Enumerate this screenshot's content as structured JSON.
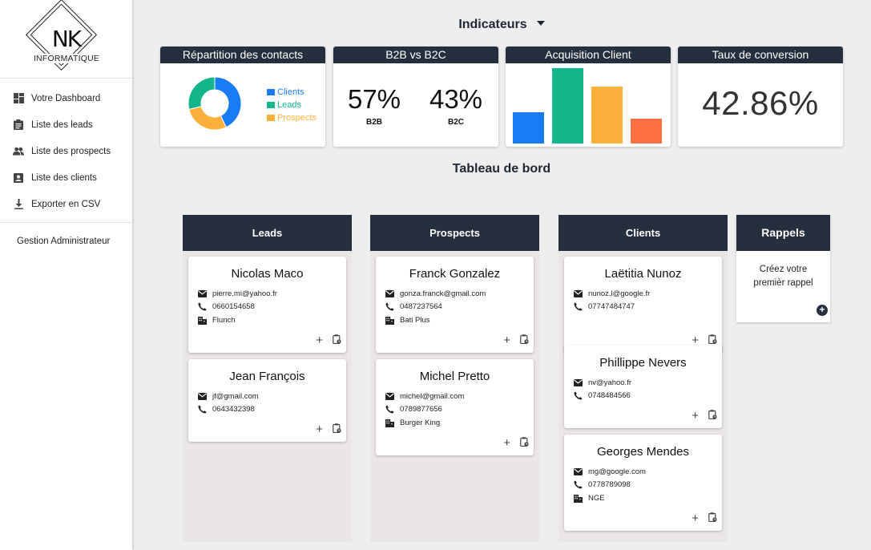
{
  "brand": {
    "logo_mark": "NK",
    "logo_text": "INFORMATIQUE"
  },
  "sidebar": {
    "items": [
      {
        "label": "Votre Dashboard",
        "icon": "dashboard-icon"
      },
      {
        "label": "Liste des leads",
        "icon": "clipboard-icon"
      },
      {
        "label": "Liste des prospects",
        "icon": "people-icon"
      },
      {
        "label": "Liste des clients",
        "icon": "contact-card-icon"
      },
      {
        "label": "Exporter en CSV",
        "icon": "download-icon"
      }
    ],
    "admin_label": "Gestion Administrateur"
  },
  "indicators": {
    "title": "Indicateurs",
    "contacts": {
      "title": "Répartition des contacts",
      "legend": [
        {
          "label": "Clients",
          "color": "#1a7cf5",
          "value": 3
        },
        {
          "label": "Leads",
          "color": "#12b68a",
          "value": 2
        },
        {
          "label": "Prospects",
          "color": "#fbb03b",
          "value": 2
        }
      ]
    },
    "b2b": {
      "title": "B2B vs B2C",
      "b2b_value": "57%",
      "b2b_label": "B2B",
      "b2c_value": "43%",
      "b2c_label": "B2C"
    },
    "acquisition": {
      "title": "Acquisition Client",
      "values": [
        40,
        97,
        73,
        32
      ],
      "max": 100,
      "colors": [
        "#1a7cf5",
        "#12b68a",
        "#fbb03b",
        "#ff7043"
      ]
    },
    "conversion": {
      "title": "Taux de conversion",
      "value": "42.86%"
    }
  },
  "dashboard": {
    "title": "Tableau de bord",
    "columns": [
      {
        "title": "Leads",
        "cards": [
          {
            "name": "Nicolas Maco",
            "email": "pierre.mi@yahoo.fr",
            "phone": "0660154658",
            "company": "Flunch"
          },
          {
            "name": "Jean François",
            "email": "jf@gmail.com",
            "phone": "0643432398",
            "company": ""
          }
        ]
      },
      {
        "title": "Prospects",
        "cards": [
          {
            "name": "Franck Gonzalez",
            "email": "gonza.franck@gmail.com",
            "phone": "0487237564",
            "company": "Bati Plus"
          },
          {
            "name": "Michel Pretto",
            "email": "michel@gmail.com",
            "phone": "0789877656",
            "company": "Burger King"
          }
        ]
      },
      {
        "title": "Clients",
        "cards": [
          {
            "name": "Laëtitia Nunoz",
            "email": "nunoz.l@google.fr",
            "phone": "07747484747",
            "company": ""
          },
          {
            "name": "Phillippe Nevers",
            "email": "nv@yahoo.fr",
            "phone": "0748484566",
            "company": ""
          },
          {
            "name": "Georges Mendes",
            "email": "mg@google.com",
            "phone": "0778789098",
            "company": "NGE"
          }
        ]
      }
    ],
    "reminders": {
      "title": "Rappels",
      "empty_text_line1": "Créez votre",
      "empty_text_line2": "premièr rappel"
    }
  }
}
